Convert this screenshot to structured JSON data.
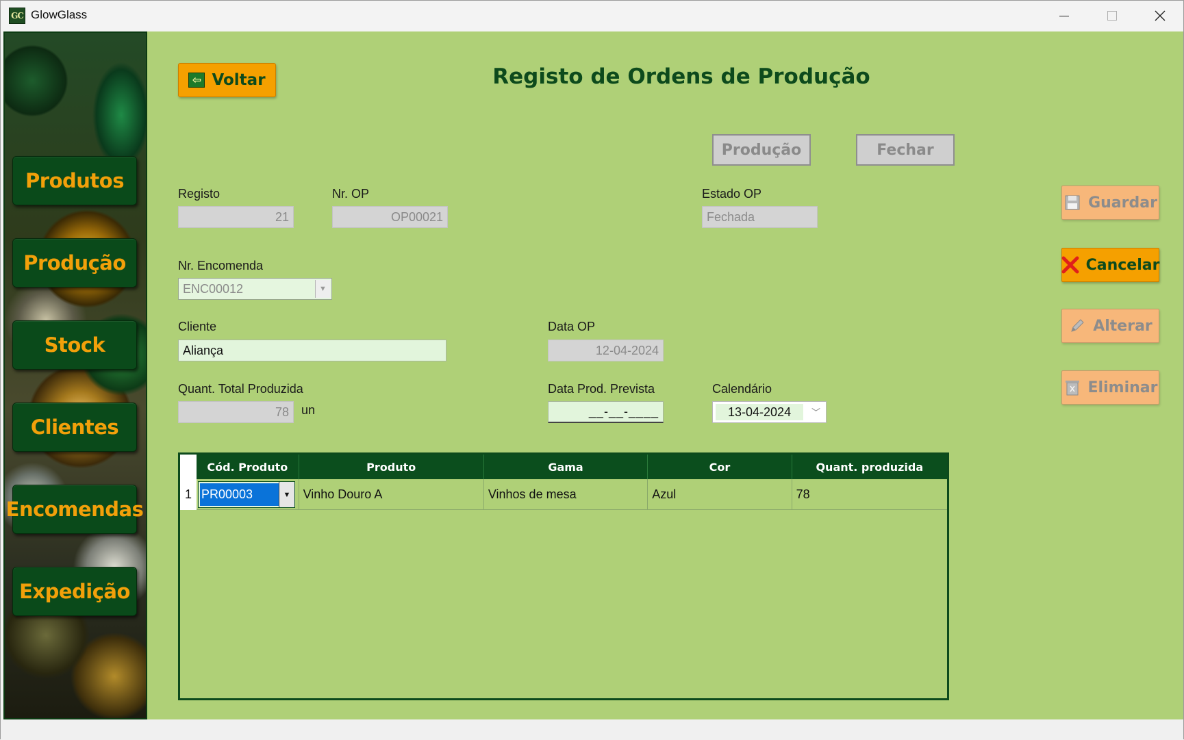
{
  "window": {
    "app_icon_text": "GC",
    "title": "GlowGlass",
    "controls": {
      "minimize": "—",
      "maximize": "☐",
      "close": "✕"
    }
  },
  "sidebar": {
    "items": [
      {
        "label": "Produtos"
      },
      {
        "label": "Produção"
      },
      {
        "label": "Stock"
      },
      {
        "label": "Clientes"
      },
      {
        "label": "Encomendas"
      },
      {
        "label": "Expedição"
      }
    ]
  },
  "header": {
    "back_label": "Voltar",
    "title": "Registo de Ordens de Produção"
  },
  "top_actions": {
    "producao_label": "Produção",
    "fechar_label": "Fechar"
  },
  "form": {
    "registo": {
      "label": "Registo",
      "value": "21"
    },
    "nr_op": {
      "label": "Nr. OP",
      "value": "OP00021"
    },
    "estado_op": {
      "label": "Estado OP",
      "value": "Fechada"
    },
    "nr_encomenda": {
      "label": "Nr. Encomenda",
      "value": "ENC00012"
    },
    "cliente": {
      "label": "Cliente",
      "value": "Aliança"
    },
    "data_op": {
      "label": "Data OP",
      "value": "12-04-2024"
    },
    "quant_total": {
      "label": "Quant. Total Produzida",
      "value": "78",
      "unit": "un"
    },
    "data_prod_prevista": {
      "label": "Data Prod. Prevista",
      "value": "__-__-____"
    },
    "calendario": {
      "label": "Calendário",
      "value": "13-04-2024"
    }
  },
  "actions": {
    "guardar": "Guardar",
    "cancelar": "Cancelar",
    "alterar": "Alterar",
    "eliminar": "Eliminar"
  },
  "grid": {
    "columns": [
      "Cód. Produto",
      "Produto",
      "Gama",
      "Cor",
      "Quant. produzida"
    ],
    "rows": [
      {
        "num": "1",
        "cod": "PR00003",
        "produto": "Vinho Douro A",
        "gama": "Vinhos de mesa",
        "cor": "Azul",
        "quant": "78"
      }
    ]
  },
  "colors": {
    "main_bg": "#afd077",
    "dark_green": "#0b4e1d",
    "orange": "#f5a000",
    "orange_disabled": "#f7b77a"
  }
}
